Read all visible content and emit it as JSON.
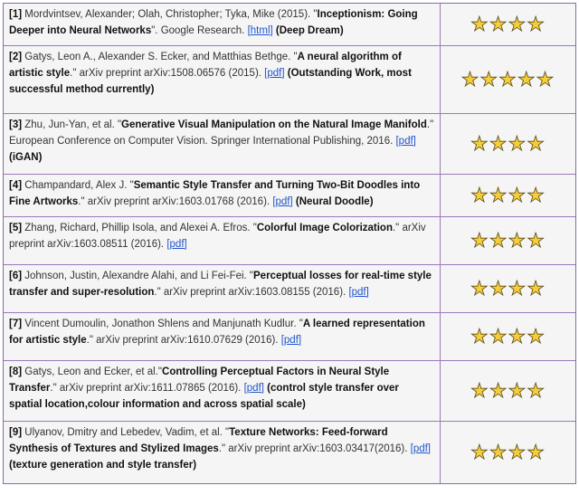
{
  "references": [
    {
      "num": "[1]",
      "pre": " Mordvintsev, Alexander; Olah, Christopher; Tyka, Mike (2015). \"",
      "title": "Inceptionism: Going Deeper into Neural Networks",
      "post": "\". Google Research. ",
      "link": "[html]",
      "note": "(Deep Dream)",
      "rating": 4
    },
    {
      "num": "[2]",
      "pre": " Gatys, Leon A., Alexander S. Ecker, and Matthias Bethge. \"",
      "title": "A neural algorithm of artistic style",
      "post": ".\" arXiv preprint arXiv:1508.06576 (2015). ",
      "link": "[pdf]",
      "note": "(Outstanding Work, most successful method currently)",
      "rating": 5
    },
    {
      "num": "[3]",
      "pre": " Zhu, Jun-Yan, et al. \"",
      "title": "Generative Visual Manipulation on the Natural Image Manifold",
      "post": ".\" European Conference on Computer Vision. Springer International Publishing, 2016. ",
      "link": "[pdf]",
      "note": "(iGAN)",
      "rating": 4
    },
    {
      "num": "[4]",
      "pre": " Champandard, Alex J. \"",
      "title": "Semantic Style Transfer and Turning Two-Bit Doodles into Fine Artworks",
      "post": ".\" arXiv preprint arXiv:1603.01768 (2016). ",
      "link": "[pdf]",
      "note": "(Neural Doodle)",
      "rating": 4
    },
    {
      "num": "[5]",
      "pre": " Zhang, Richard, Phillip Isola, and Alexei A. Efros. \"",
      "title": "Colorful Image Colorization",
      "post": ".\" arXiv preprint arXiv:1603.08511 (2016). ",
      "link": "[pdf]",
      "note": "",
      "rating": 4
    },
    {
      "num": "[6]",
      "pre": " Johnson, Justin, Alexandre Alahi, and Li Fei-Fei. \"",
      "title": "Perceptual losses for real-time style transfer and super-resolution",
      "post": ".\" arXiv preprint arXiv:1603.08155 (2016). ",
      "link": "[pdf]",
      "note": "",
      "rating": 4
    },
    {
      "num": "[7]",
      "pre": " Vincent Dumoulin, Jonathon Shlens and Manjunath Kudlur. \"",
      "title": "A learned representation for artistic style",
      "post": ".\" arXiv preprint arXiv:1610.07629 (2016). ",
      "link": "[pdf]",
      "note": "",
      "rating": 4
    },
    {
      "num": "[8]",
      "pre": " Gatys, Leon and Ecker, et al.\"",
      "title": "Controlling Perceptual Factors in Neural Style Transfer",
      "post": ".\" arXiv preprint arXiv:1611.07865 (2016). ",
      "link": "[pdf]",
      "note": "(control style transfer over spatial location,colour information and across spatial scale)",
      "rating": 4
    },
    {
      "num": "[9]",
      "pre": " Ulyanov, Dmitry and Lebedev, Vadim, et al. \"",
      "title": "Texture Networks: Feed-forward Synthesis of Textures and Stylized Images",
      "post": ".\" arXiv preprint arXiv:1603.03417(2016). ",
      "link": "[pdf]",
      "note": "(texture generation and style transfer)",
      "rating": 4
    }
  ],
  "star_glyph": "★",
  "colors": {
    "star": "#f3cd3a",
    "border": "#9a7ab8",
    "link": "#2255cc",
    "background": "#f5f5f5"
  }
}
